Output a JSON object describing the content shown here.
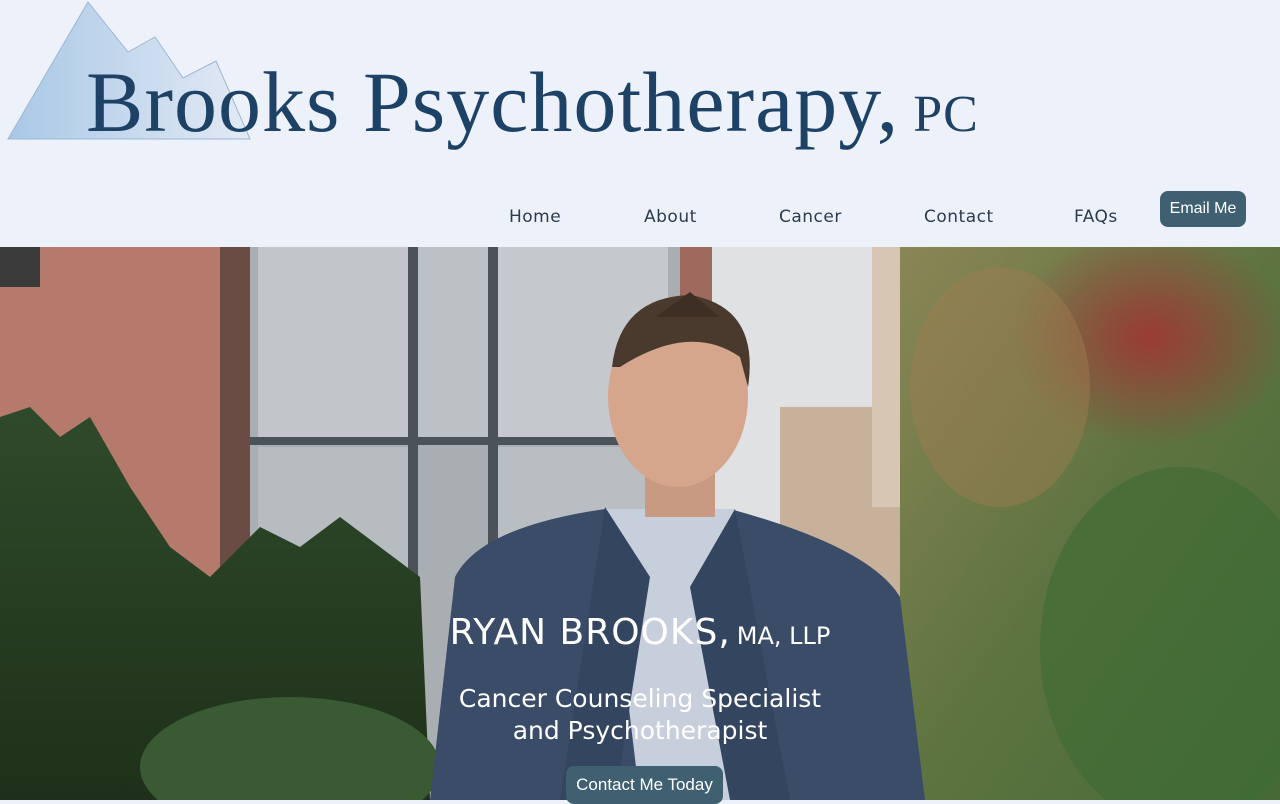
{
  "brand": {
    "name": "Brooks Psychotherapy,",
    "suffix": "PC"
  },
  "nav": {
    "items": [
      "Home",
      "About",
      "Cancer",
      "Contact",
      "FAQs"
    ],
    "email_label": "Email Me"
  },
  "hero": {
    "name": "RYAN BROOKS,",
    "credentials": "MA, LLP",
    "subtitle_line1": "Cancer Counseling Specialist",
    "subtitle_line2": "and Psychotherapist",
    "cta_label": "Contact Me Today"
  },
  "colors": {
    "brand_text": "#1d4266",
    "button": "#3e6070",
    "header_bg": "#edf1f9"
  }
}
